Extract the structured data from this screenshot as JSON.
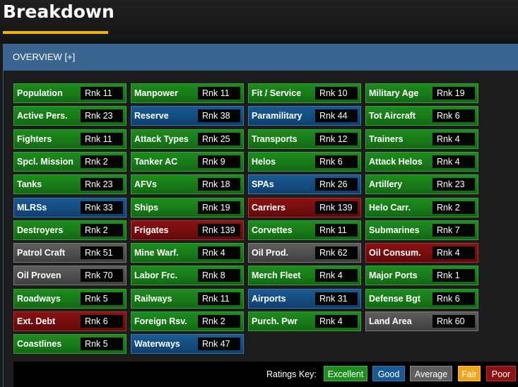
{
  "header": {
    "title": "Breakdown"
  },
  "overview": {
    "label": "OVERVIEW [+]"
  },
  "colors": {
    "excellent": "#1e8c1e",
    "good": "#1a5a92",
    "average": "#5e5e5e",
    "fair": "#f2a51a",
    "poor": "#8a1212",
    "accent": "#f5b400"
  },
  "stats": [
    {
      "label": "Population",
      "rank": "Rnk 11",
      "rating": "excellent"
    },
    {
      "label": "Manpower",
      "rank": "Rnk 11",
      "rating": "excellent"
    },
    {
      "label": "Fit / Service",
      "rank": "Rnk 10",
      "rating": "excellent"
    },
    {
      "label": "Military Age",
      "rank": "Rnk 19",
      "rating": "excellent"
    },
    {
      "label": "Active Pers.",
      "rank": "Rnk 23",
      "rating": "excellent"
    },
    {
      "label": "Reserve",
      "rank": "Rnk 38",
      "rating": "good"
    },
    {
      "label": "Paramilitary",
      "rank": "Rnk 44",
      "rating": "good"
    },
    {
      "label": "Tot Aircraft",
      "rank": "Rnk 6",
      "rating": "excellent"
    },
    {
      "label": "Fighters",
      "rank": "Rnk 11",
      "rating": "excellent"
    },
    {
      "label": "Attack Types",
      "rank": "Rnk 25",
      "rating": "excellent"
    },
    {
      "label": "Transports",
      "rank": "Rnk 12",
      "rating": "excellent"
    },
    {
      "label": "Trainers",
      "rank": "Rnk 4",
      "rating": "excellent"
    },
    {
      "label": "Spcl. Mission",
      "rank": "Rnk 2",
      "rating": "excellent"
    },
    {
      "label": "Tanker AC",
      "rank": "Rnk 9",
      "rating": "excellent"
    },
    {
      "label": "Helos",
      "rank": "Rnk 6",
      "rating": "excellent"
    },
    {
      "label": "Attack Helos",
      "rank": "Rnk 4",
      "rating": "excellent"
    },
    {
      "label": "Tanks",
      "rank": "Rnk 23",
      "rating": "excellent"
    },
    {
      "label": "AFVs",
      "rank": "Rnk 18",
      "rating": "excellent"
    },
    {
      "label": "SPAs",
      "rank": "Rnk 26",
      "rating": "good"
    },
    {
      "label": "Artillery",
      "rank": "Rnk 23",
      "rating": "excellent"
    },
    {
      "label": "MLRSs",
      "rank": "Rnk 33",
      "rating": "good"
    },
    {
      "label": "Ships",
      "rank": "Rnk 19",
      "rating": "excellent"
    },
    {
      "label": "Carriers",
      "rank": "Rnk 139",
      "rating": "poor"
    },
    {
      "label": "Helo Carr.",
      "rank": "Rnk 2",
      "rating": "excellent"
    },
    {
      "label": "Destroyers",
      "rank": "Rnk 2",
      "rating": "excellent"
    },
    {
      "label": "Frigates",
      "rank": "Rnk 139",
      "rating": "poor"
    },
    {
      "label": "Corvettes",
      "rank": "Rnk 11",
      "rating": "excellent"
    },
    {
      "label": "Submarines",
      "rank": "Rnk 7",
      "rating": "excellent"
    },
    {
      "label": "Patrol Craft",
      "rank": "Rnk 51",
      "rating": "average"
    },
    {
      "label": "Mine Warf.",
      "rank": "Rnk 4",
      "rating": "excellent"
    },
    {
      "label": "Oil Prod.",
      "rank": "Rnk 62",
      "rating": "average"
    },
    {
      "label": "Oil Consum.",
      "rank": "Rnk 4",
      "rating": "poor"
    },
    {
      "label": "Oil Proven",
      "rank": "Rnk 70",
      "rating": "average"
    },
    {
      "label": "Labor Frc.",
      "rank": "Rnk 8",
      "rating": "excellent"
    },
    {
      "label": "Merch Fleet",
      "rank": "Rnk 4",
      "rating": "excellent"
    },
    {
      "label": "Major Ports",
      "rank": "Rnk 1",
      "rating": "excellent"
    },
    {
      "label": "Roadways",
      "rank": "Rnk 5",
      "rating": "excellent"
    },
    {
      "label": "Railways",
      "rank": "Rnk 11",
      "rating": "excellent"
    },
    {
      "label": "Airports",
      "rank": "Rnk 31",
      "rating": "good"
    },
    {
      "label": "Defense Bgt",
      "rank": "Rnk 6",
      "rating": "excellent"
    },
    {
      "label": "Ext. Debt",
      "rank": "Rnk 6",
      "rating": "poor"
    },
    {
      "label": "Foreign Rsv.",
      "rank": "Rnk 2",
      "rating": "excellent"
    },
    {
      "label": "Purch. Pwr",
      "rank": "Rnk 4",
      "rating": "excellent"
    },
    {
      "label": "Land Area",
      "rank": "Rnk 60",
      "rating": "average"
    },
    {
      "label": "Coastlines",
      "rank": "Rnk 5",
      "rating": "excellent"
    },
    {
      "label": "Waterways",
      "rank": "Rnk 47",
      "rating": "good"
    }
  ],
  "ratings_key": {
    "label": "Ratings Key:",
    "excellent": "Excellent",
    "good": "Good",
    "average": "Average",
    "fair": "Fair",
    "poor": "Poor"
  }
}
